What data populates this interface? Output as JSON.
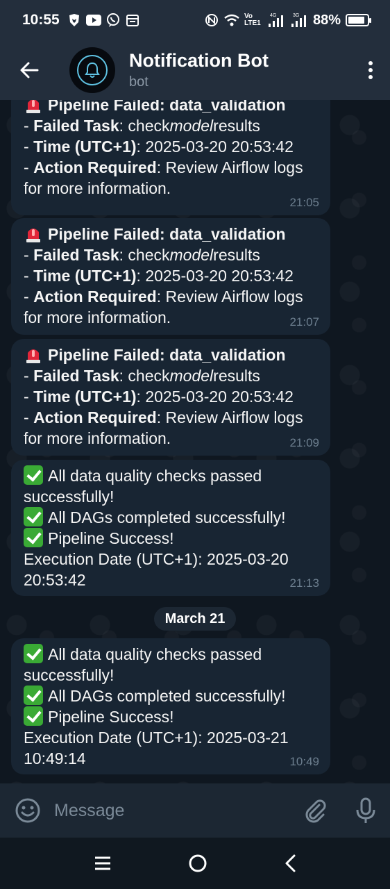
{
  "status_bar": {
    "time": "10:55",
    "network_label": "Vo LTE1",
    "net1": "4G",
    "net2": "3G",
    "battery_percent": "88%",
    "battery_level": 0.88
  },
  "header": {
    "title": "Notification Bot",
    "subtitle": "bot",
    "accent": "#5fc3e4"
  },
  "messages": [
    {
      "title": "Pipeline Failed: data_validation",
      "task_label": "Failed Task",
      "task_pre": "check",
      "task_mid": "model",
      "task_post": "results",
      "time_label": "Time (UTC+1)",
      "time_value": "2025-03-20 20:53:42",
      "action_label": "Action Required",
      "action_value": "Review Airflow logs",
      "action_cont": "for more information.",
      "sent": "21:05"
    },
    {
      "title": "Pipeline Failed: data_validation",
      "task_label": "Failed Task",
      "task_pre": "check",
      "task_mid": "model",
      "task_post": "results",
      "time_label": "Time (UTC+1)",
      "time_value": "2025-03-20 20:53:42",
      "action_label": "Action Required",
      "action_value": "Review Airflow logs",
      "action_cont": "for more information.",
      "sent": "21:07"
    },
    {
      "title": "Pipeline Failed: data_validation",
      "task_label": "Failed Task",
      "task_pre": "check",
      "task_mid": "model",
      "task_post": "results",
      "time_label": "Time (UTC+1)",
      "time_value": "2025-03-20 20:53:42",
      "action_label": "Action Required",
      "action_value": "Review Airflow logs",
      "action_cont": "for more information.",
      "sent": "21:09"
    },
    {
      "line1": "All data quality checks passed",
      "line1b": "successfully!",
      "line2": "All DAGs completed successfully!",
      "line3": "Pipeline Success!",
      "exec_label": "Execution Date (UTC+1)",
      "exec_date": "2025-03-20",
      "exec_time": "20:53:42",
      "sent": "21:13"
    },
    {
      "line1": "All data quality checks passed",
      "line1b": "successfully!",
      "line2": "All DAGs completed successfully!",
      "line3": "Pipeline Success!",
      "exec_label": "Execution Date (UTC+1)",
      "exec_date": "2025-03-21",
      "exec_time": "10:49:14",
      "sent": "10:49"
    }
  ],
  "date_separator": "March 21",
  "input": {
    "placeholder": "Message"
  },
  "icons": {
    "back": "arrow-left-icon",
    "menu": "more-vertical-icon",
    "emoji": "smile-icon",
    "attach": "paperclip-icon",
    "mic": "microphone-icon",
    "alarm": "rotating-light-icon",
    "check": "check-mark-button-icon"
  }
}
